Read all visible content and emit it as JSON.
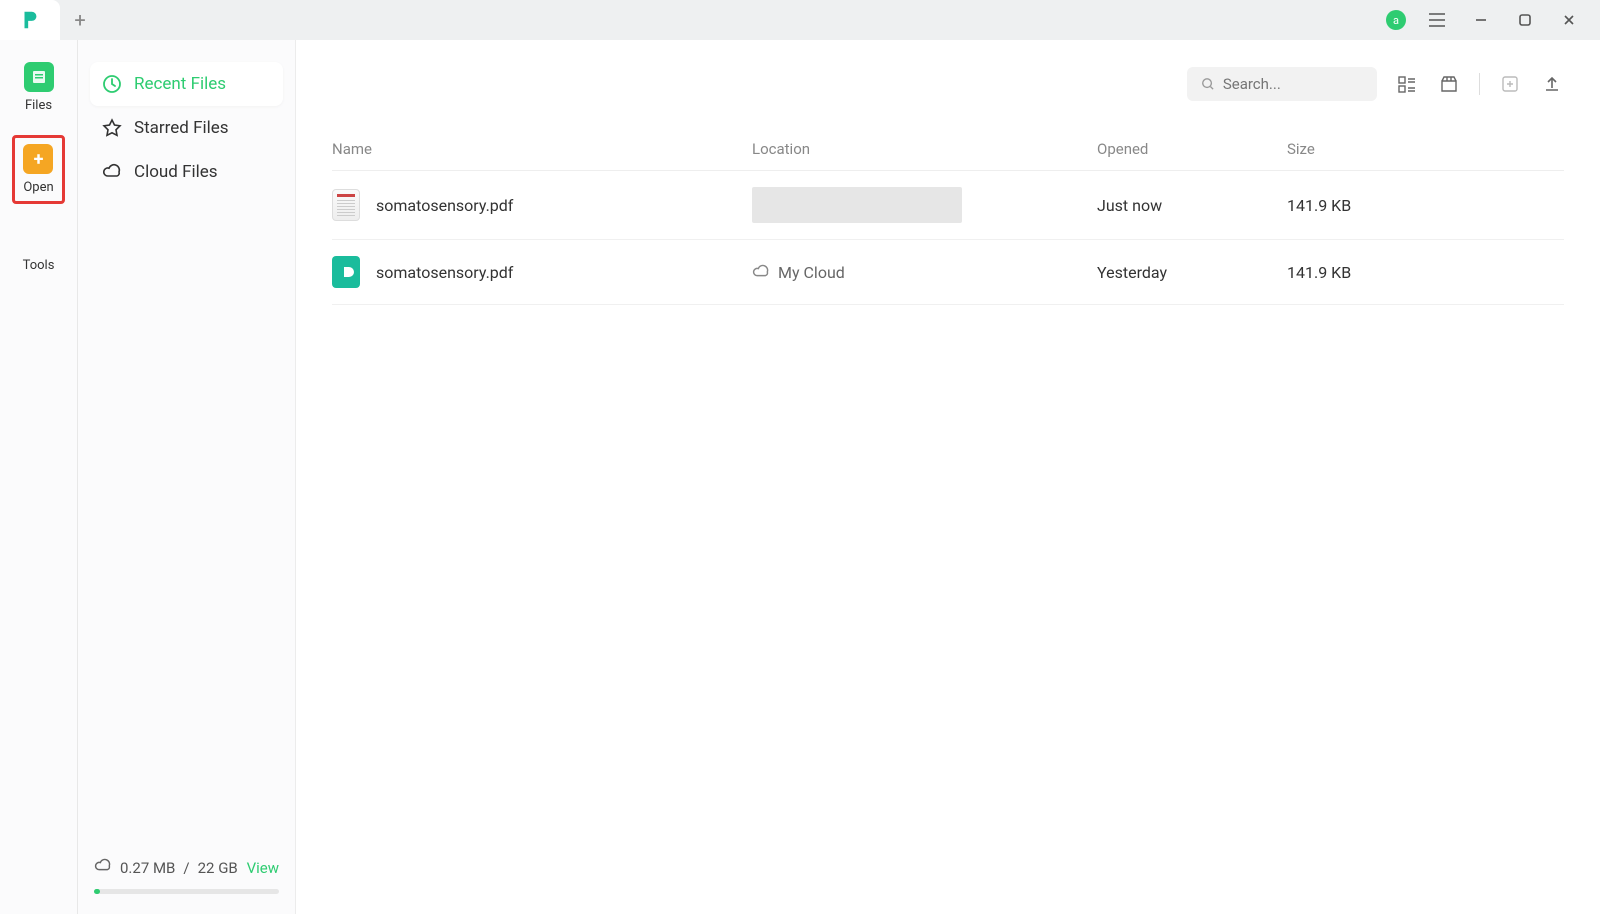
{
  "titlebar": {
    "avatar_initial": "a"
  },
  "rail": {
    "files": "Files",
    "open": "Open",
    "tools": "Tools"
  },
  "sidebar": {
    "items": [
      {
        "label": "Recent Files",
        "active": true
      },
      {
        "label": "Starred Files",
        "active": false
      },
      {
        "label": "Cloud Files",
        "active": false
      }
    ],
    "storage": {
      "used": "0.27 MB",
      "sep": "/",
      "total": "22 GB",
      "view": "View"
    }
  },
  "toolbar": {
    "search_placeholder": "Search..."
  },
  "table": {
    "headers": {
      "name": "Name",
      "location": "Location",
      "opened": "Opened",
      "size": "Size"
    },
    "rows": [
      {
        "name": "somatosensory.pdf",
        "location_type": "redacted",
        "location": "",
        "opened": "Just now",
        "size": "141.9 KB",
        "icon": "doc"
      },
      {
        "name": "somatosensory.pdf",
        "location_type": "cloud",
        "location": "My Cloud",
        "opened": "Yesterday",
        "size": "141.9 KB",
        "icon": "cloud"
      }
    ]
  }
}
